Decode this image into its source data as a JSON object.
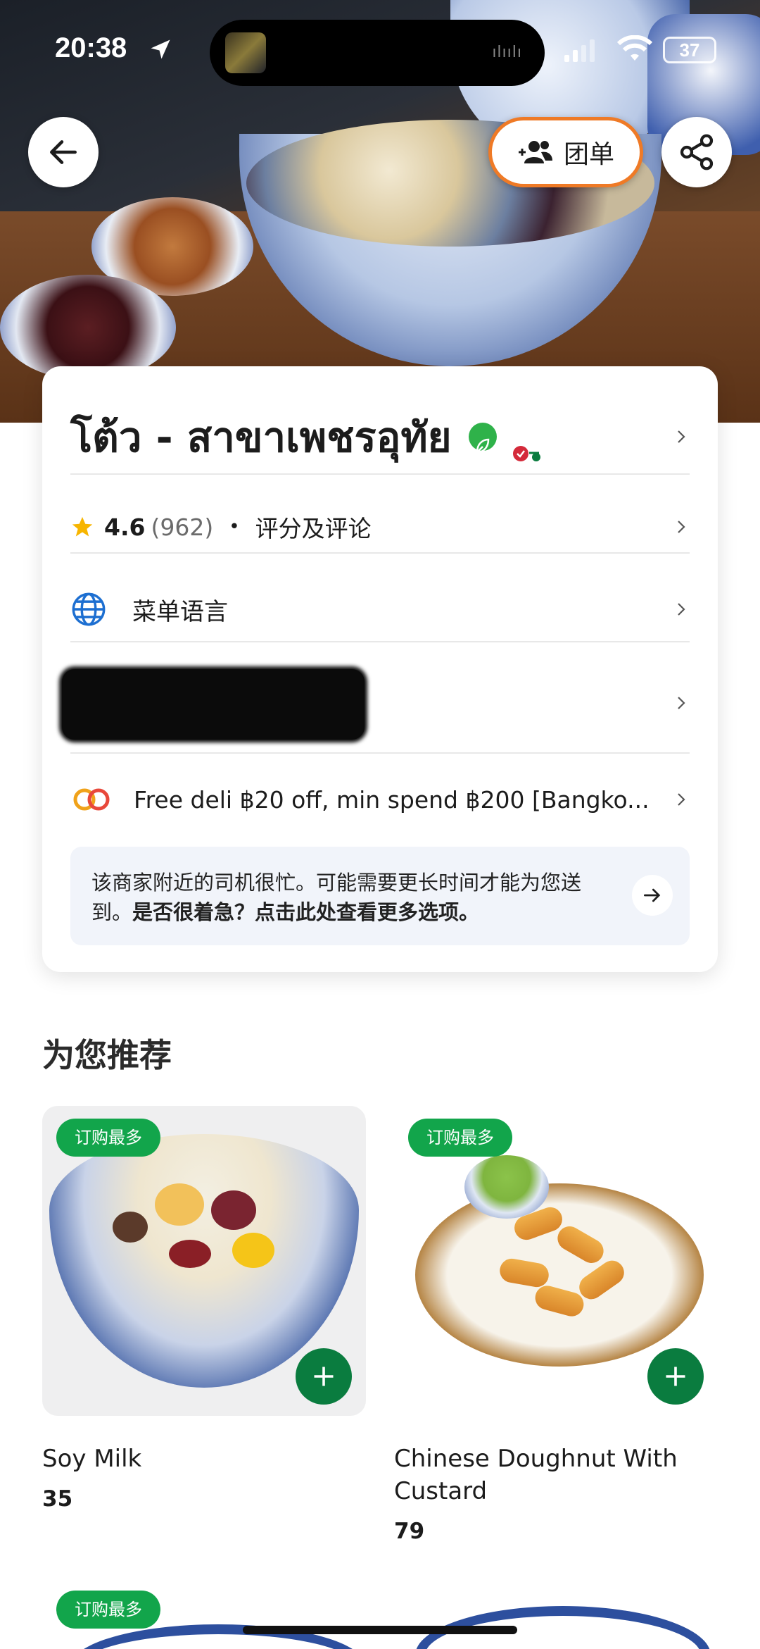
{
  "status_bar": {
    "time": "20:38",
    "battery": "37",
    "icons": [
      "location-arrow-icon",
      "cellular-signal-icon",
      "wifi-icon",
      "battery-icon"
    ]
  },
  "header": {
    "back_icon": "arrow-left-icon",
    "group_order_label": "团单",
    "group_icon": "people-plus-icon",
    "share_icon": "share-icon",
    "accent_color": "#ef7a26"
  },
  "store": {
    "name": "โต้ว - สาขาเพชรอุทัย",
    "badges": [
      "eco-leaf-badge",
      "scooter-delivery-badge"
    ],
    "rating": "4.6",
    "review_count": "(962)",
    "reviews_label": "评分及评论",
    "menu_language_label": "菜单语言",
    "promo_text": "Free deli ฿20 off, min spend ฿200 [Bangko...",
    "notice_normal": "该商家附近的司机很忙。可能需要更长时间才能为您送到。",
    "notice_bold": "是否很着急？点击此处查看更多选项。"
  },
  "recommendations": {
    "title": "为您推荐",
    "items": [
      {
        "tag": "订购最多",
        "name": "Soy Milk",
        "price": "35"
      },
      {
        "tag": "订购最多",
        "name": "Chinese Doughnut With Custard",
        "price": "79"
      },
      {
        "tag": "订购最多"
      },
      {}
    ]
  },
  "colors": {
    "brand_green": "#12a54b",
    "add_button_green": "#0a7c3f",
    "notice_bg": "#f1f4fa"
  }
}
